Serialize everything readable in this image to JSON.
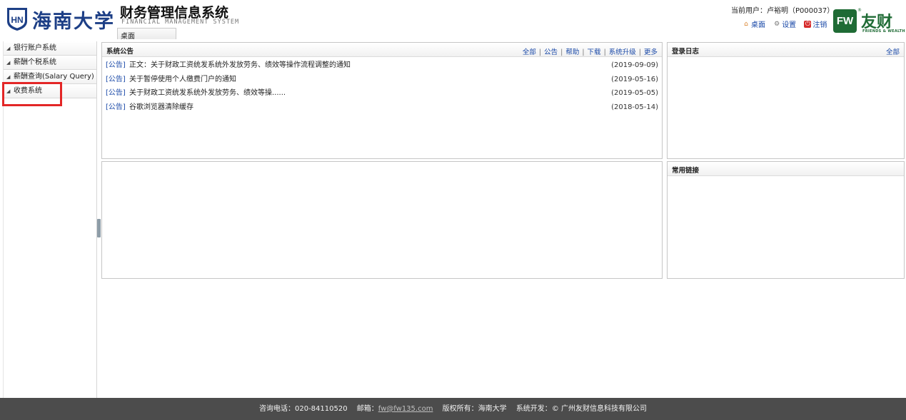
{
  "header": {
    "university_name": "海南大学",
    "system_title": "财务管理信息系统",
    "system_subtitle": "FINANCIAL MANAGEMENT SYSTEM",
    "tab_label": "桌面",
    "current_user": "当前用户：卢裕明（P000037）",
    "links": [
      {
        "label": "桌面",
        "icon": "home-icon"
      },
      {
        "label": "设置",
        "icon": "gear-icon"
      },
      {
        "label": "注销",
        "icon": "power-icon"
      }
    ],
    "brand": {
      "mark": "FW",
      "name": "友财",
      "tagline": "FRIENDS & WEALTH",
      "reg": "®"
    }
  },
  "sidebar": {
    "items": [
      {
        "label": "银行账户系统"
      },
      {
        "label": "薪酬个税系统"
      },
      {
        "label": "薪酬查询(Salary Query)"
      },
      {
        "label": "收费系统"
      }
    ],
    "highlight_color": "#e32626"
  },
  "notice_panel": {
    "title": "系统公告",
    "links": [
      "全部",
      "公告",
      "帮助",
      "下载",
      "系统升级",
      "更多"
    ],
    "rows": [
      {
        "tag": "[公告]",
        "text": "正文：关于财政工资统发系统外发放劳务、绩效等操作流程调整的通知",
        "date": "(2019-09-09)"
      },
      {
        "tag": "[公告]",
        "text": "关于暂停使用个人缴费门户的通知",
        "date": "(2019-05-16)"
      },
      {
        "tag": "[公告]",
        "text": "关于财政工资统发系统外发放劳务、绩效等操......",
        "date": "(2019-05-05)"
      },
      {
        "tag": "[公告]",
        "text": "谷歌浏览器清除缓存",
        "date": "(2018-05-14)"
      }
    ]
  },
  "login_panel": {
    "title": "登录日志",
    "link": "全部"
  },
  "links_panel": {
    "title": "常用链接"
  },
  "footer": {
    "phone_label": "咨询电话：",
    "phone": "020-84110520",
    "email_label": "邮箱：",
    "email": "fw@fw135.com",
    "copyright_label": "版权所有：",
    "copyright": "海南大学",
    "developer_label": "系统开发：",
    "developer": "© 广州友财信息科技有限公司"
  },
  "colors": {
    "link": "#1b4aa8",
    "brand_green": "#1f6b35",
    "univ_blue": "#1d3f86",
    "footer_bg": "#4c4c4c"
  }
}
